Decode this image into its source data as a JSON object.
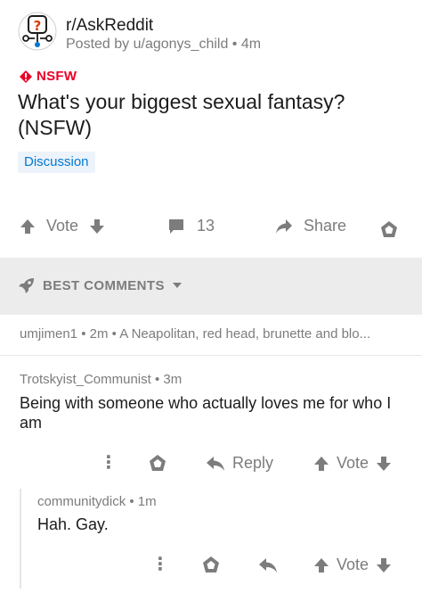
{
  "post": {
    "subreddit": "r/AskReddit",
    "posted_by": "Posted by u/agonys_child",
    "age": "4m",
    "nsfw_label": "NSFW",
    "title": "What's your biggest sexual fantasy? (NSFW)",
    "flair": "Discussion"
  },
  "actions": {
    "vote_label": "Vote",
    "comment_count": "13",
    "share_label": "Share"
  },
  "sort": {
    "label": "BEST COMMENTS"
  },
  "collapsed_comment": {
    "author": "umjimen1",
    "age": "2m",
    "preview": "A Neapolitan, red head, brunette and blo..."
  },
  "comments": [
    {
      "author": "Trotskyist_Communist",
      "age": "3m",
      "body": "Being with someone who actually loves me for who I am",
      "reply_label": "Reply",
      "vote_label": "Vote"
    },
    {
      "author": "communitydick",
      "age": "1m",
      "body": "Hah. Gay.",
      "vote_label": "Vote"
    }
  ],
  "colors": {
    "nsfw": "#ea0027",
    "flair_text": "#0079d3",
    "flair_bg": "#edf3fa",
    "muted": "#7c7c7c",
    "sort_bar_bg": "#ececec"
  },
  "icons": [
    "subreddit-avatar-icon",
    "nsfw-diamond-icon",
    "upvote-icon",
    "downvote-icon",
    "comment-icon",
    "share-icon",
    "award-icon",
    "rocket-icon",
    "chevron-down-icon",
    "more-icon",
    "reply-icon"
  ]
}
